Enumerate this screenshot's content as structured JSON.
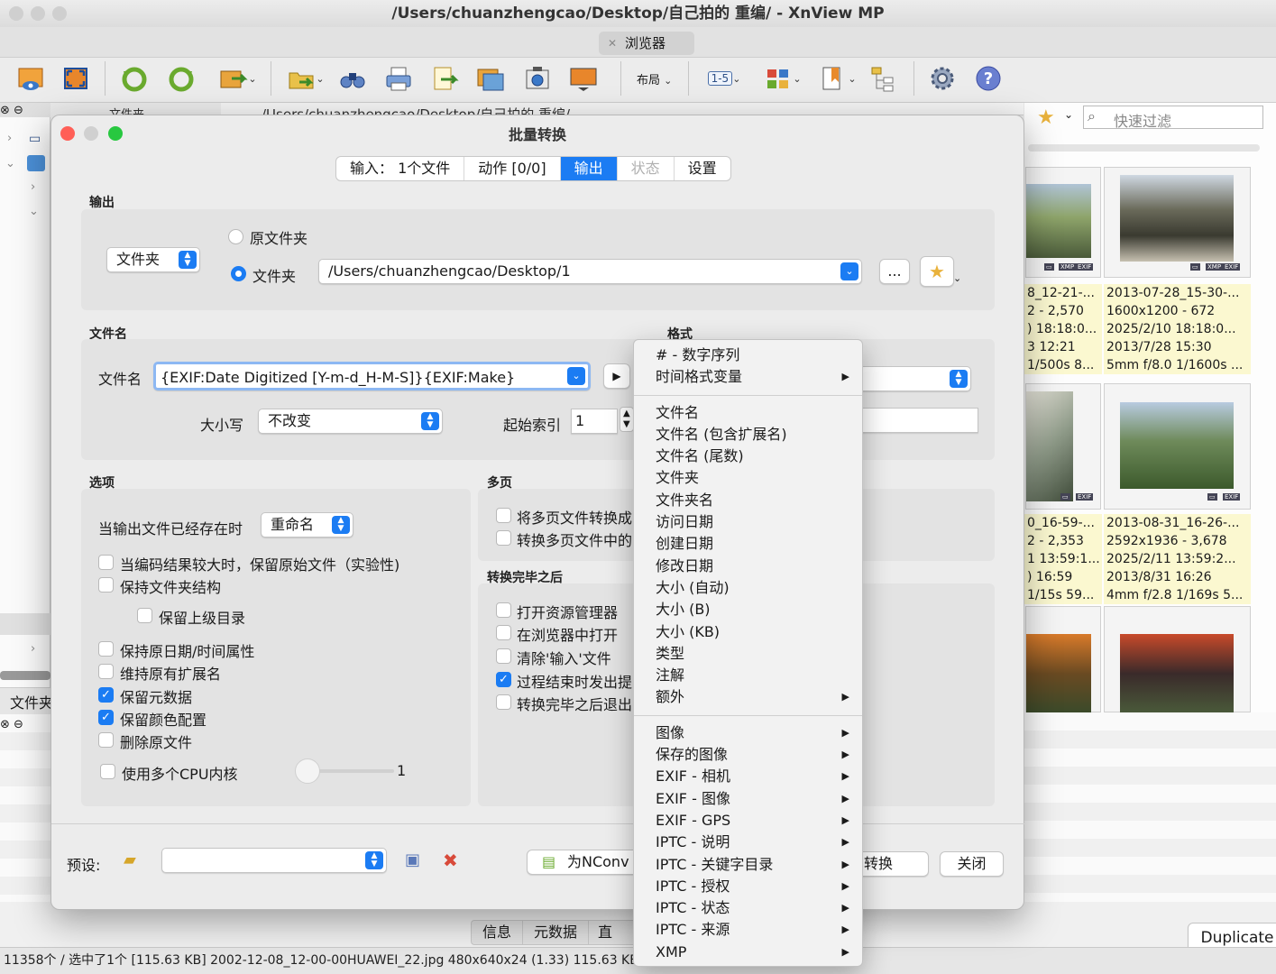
{
  "window": {
    "title": "/Users/chuanzhengcao/Desktop/自己拍的 重编/ - XnView MP",
    "browser_tab": "浏览器"
  },
  "toolbar": {
    "layout_label": "布局",
    "page_label": "1-5"
  },
  "left_pane": {
    "folder_header": "文件夹",
    "folder_tab": "文件夹"
  },
  "path_bar": {
    "path": "/Users/chuanzhengcao/Desktop/自己拍的 重编/"
  },
  "quick_filter": {
    "placeholder": "快速过滤"
  },
  "thumbnails": [
    {
      "line1": "8_12-21-...",
      "line2": "2 - 2,570",
      "line3": ") 18:18:0...",
      "line4": "3 12:21",
      "line5": "1/500s 8..."
    },
    {
      "line1": "2013-07-28_15-30-...",
      "line2": "1600x1200 - 672",
      "line3": "2025/2/10 18:18:0...",
      "line4": "2013/7/28 15:30",
      "line5": "5mm f/8.0 1/1600s ..."
    },
    {
      "line1": "0_16-59-...",
      "line2": "2 - 2,353",
      "line3": "1 13:59:1...",
      "line4": ") 16:59",
      "line5": "1/15s 59..."
    },
    {
      "line1": "2013-08-31_16-26-...",
      "line2": "2592x1936 - 3,678",
      "line3": "2025/2/11 13:59:2...",
      "line4": "2013/8/31 16:26",
      "line5": "4mm f/2.8 1/169s 5..."
    }
  ],
  "thumb_badges": {
    "xmp": "XMP",
    "exif": "EXIF"
  },
  "dialog": {
    "title": "批量转换",
    "tabs": {
      "input": "输入：  1个文件",
      "actions": "动作 [0/0]",
      "output": "输出",
      "status": "状态",
      "settings": "设置"
    },
    "output_group": {
      "label": "输出",
      "dest_type": "文件夹",
      "radio_original": "原文件夹",
      "radio_folder": "文件夹",
      "folder_path": "/Users/chuanzhengcao/Desktop/1",
      "browse_label": "..."
    },
    "filename_group": {
      "label": "文件名",
      "field_label": "文件名",
      "pattern": "{EXIF:Date Digitized [Y-m-d_H-M-S]}{EXIF:Make}",
      "case_label": "大小写",
      "case_value": "不改变",
      "start_index_label": "起始索引",
      "start_index_value": "1"
    },
    "format_group": {
      "label": "格式"
    },
    "options_group": {
      "label": "选项",
      "exists_label": "当输出文件已经存在时",
      "exists_value": "重命名",
      "keep_original_if_larger": "当编码结果较大时，保留原始文件（实验性)",
      "keep_folder_structure": "保持文件夹结构",
      "keep_parent_dir": "保留上级目录",
      "keep_datetime": "保持原日期/时间属性",
      "keep_extension": "维持原有扩展名",
      "keep_metadata": "保留元数据",
      "keep_color_profile": "保留颜色配置",
      "delete_original": "删除原文件",
      "multi_cpu": "使用多个CPU内核",
      "cpu_count": "1"
    },
    "multipage_group": {
      "label": "多页",
      "convert_multipage": "将多页文件转换成",
      "convert_multipage_2": "转换多页文件中的"
    },
    "after_group": {
      "label": "转换完毕之后",
      "open_explorer": "打开资源管理器",
      "open_browser": "在浏览器中打开",
      "clear_input": "清除'输入'文件",
      "beep": "过程结束时发出提",
      "quit": "转换完毕之后退出"
    },
    "footer": {
      "preset_label": "预设:",
      "nconvert_label": "为NConv",
      "convert_label": "转换",
      "close_label": "关闭"
    }
  },
  "context_menu": {
    "group1": [
      "# - 数字序列",
      "时间格式变量"
    ],
    "group2": [
      "文件名",
      "文件名 (包含扩展名)",
      "文件名 (尾数)",
      "文件夹",
      "文件夹名",
      "访问日期",
      "创建日期",
      "修改日期",
      "大小 (自动)",
      "大小 (B)",
      "大小 (KB)",
      "类型",
      "注解",
      "额外"
    ],
    "group3": [
      "图像",
      "保存的图像",
      "EXIF - 相机",
      "EXIF - 图像",
      "EXIF - GPS",
      "IPTC - 说明",
      "IPTC - 关键字目录",
      "IPTC - 授权",
      "IPTC - 状态",
      "IPTC - 来源",
      "XMP"
    ]
  },
  "bottom_tabs": {
    "info": "信息",
    "metadata": "元数据",
    "hist": "直"
  },
  "duplicate_button": "Duplicate",
  "statusbar": {
    "text": "11358个 / 选中了1个 [115.63 KB]   2002-12-08_12-00-00HUAWEI_22.jpg   480x640x24 (1.33)   115.63 KB"
  },
  "colors": {
    "accent": "#1b7cf3",
    "close_traffic": "#ff5f57",
    "min_traffic": "#febc2e",
    "max_traffic": "#28c840"
  }
}
